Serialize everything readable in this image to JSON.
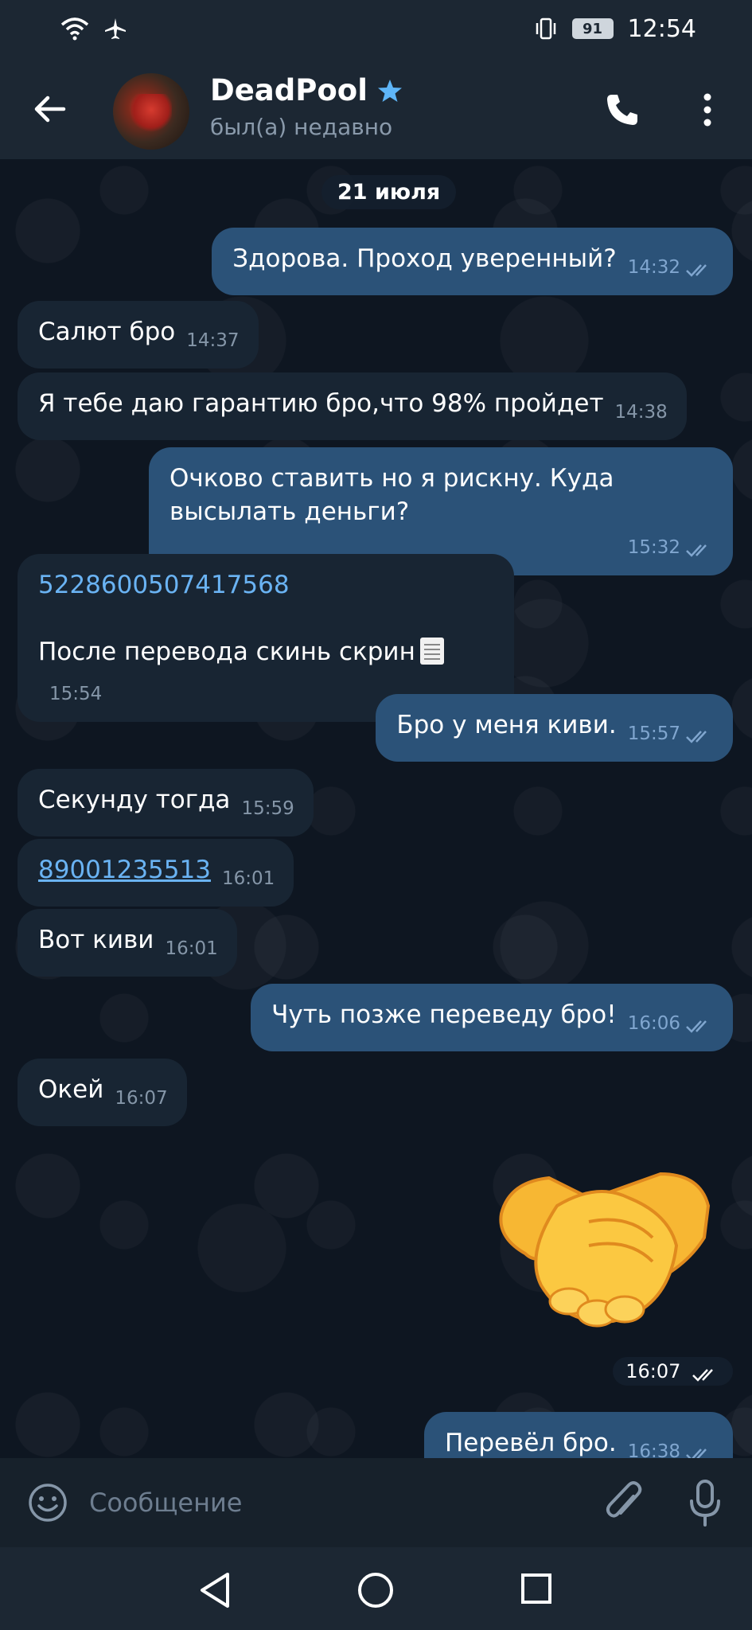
{
  "status_bar": {
    "battery": "91",
    "time": "12:54"
  },
  "header": {
    "name": "DeadPool",
    "status": "был(а) недавно"
  },
  "chat": {
    "date": "21 июля",
    "messages": [
      {
        "text": "Здорова. Проход уверенный?",
        "time": "14:32"
      },
      {
        "text": "Салют бро",
        "time": "14:37"
      },
      {
        "text": "Я тебе даю гарантию бро,что 98% пройдет",
        "time": "14:38"
      },
      {
        "text": "Очково ставить но я рискну. Куда высылать деньги?",
        "time": "15:32"
      },
      {
        "link": "5228600507417568",
        "text": "После перевода скинь скрин",
        "time": "15:54"
      },
      {
        "text": "Бро у меня киви.",
        "time": "15:57"
      },
      {
        "text": "Секунду тогда",
        "time": "15:59"
      },
      {
        "link": "89001235513",
        "time": "16:01"
      },
      {
        "text": "Вот киви",
        "time": "16:01"
      },
      {
        "text": "Чуть позже переведу бро!",
        "time": "16:06"
      },
      {
        "text": "Окей",
        "time": "16:07"
      },
      {
        "sticker": "handshake-sticker",
        "time": "16:07"
      },
      {
        "text": "Перевёл бро.",
        "time": "16:38"
      }
    ]
  },
  "input": {
    "placeholder": "Сообщение"
  },
  "colors": {
    "background": "#0e1621",
    "incoming": "#182533",
    "outgoing": "#2b5278",
    "link": "#6ab3f3",
    "star": "#5eb5f7"
  }
}
